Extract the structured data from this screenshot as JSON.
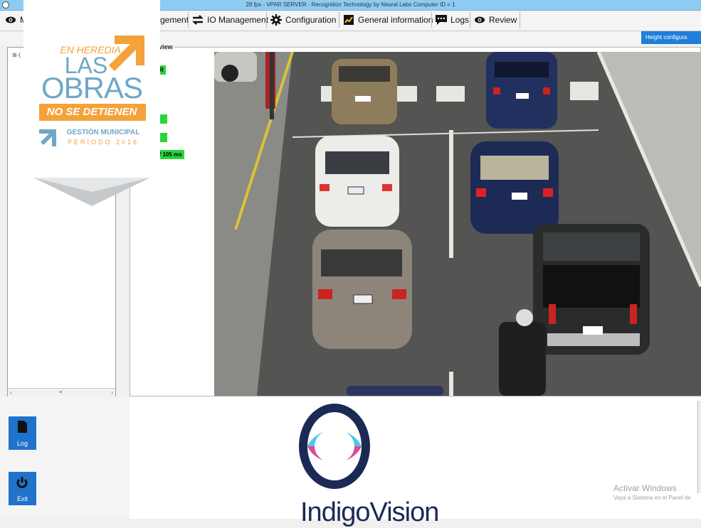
{
  "window": {
    "title": "28 fps - VPAR SERVER - Recognition Technology by Neural Labs Computer ID  = 1"
  },
  "toolbar": {
    "items": [
      {
        "label": "M",
        "icon": "eye-icon"
      },
      {
        "label": "gement",
        "icon": ""
      },
      {
        "label": "IO Management",
        "icon": "io-arrows-icon"
      },
      {
        "label": "Configuration",
        "icon": "gear-icon"
      },
      {
        "label": "General information",
        "icon": "chart-icon"
      },
      {
        "label": "Logs",
        "icon": "chat-icon"
      },
      {
        "label": "Review",
        "icon": "eye-icon"
      }
    ]
  },
  "height_config_button": "Height configura",
  "tree": {
    "root_marker": "⊞-("
  },
  "view_panel": {
    "label": "view",
    "tags": [
      "R",
      "",
      "",
      "/ 105 ms"
    ]
  },
  "bottom": {
    "log_button": "Log",
    "exit_button": "Exit",
    "logo_text": "IndigoVision",
    "watermark": {
      "line1": "Activar Windows",
      "line2": "Vaya a Sistema en el Panel de"
    }
  },
  "overlay_badge": {
    "line1": "EN HEREDIA,",
    "line2": "LAS",
    "line3": "OBRAS",
    "line4": "NO SE DETIENEN",
    "line5": "GESTIÓN MUNICIPAL",
    "line6": "PERÍODO 2016"
  },
  "colors": {
    "titlebar": "#8ecbf2",
    "accent_blue": "#1f73cc",
    "detection_green": "#2bd43b",
    "badge_orange": "#f4a23a",
    "badge_blue": "#6ea8c6"
  }
}
